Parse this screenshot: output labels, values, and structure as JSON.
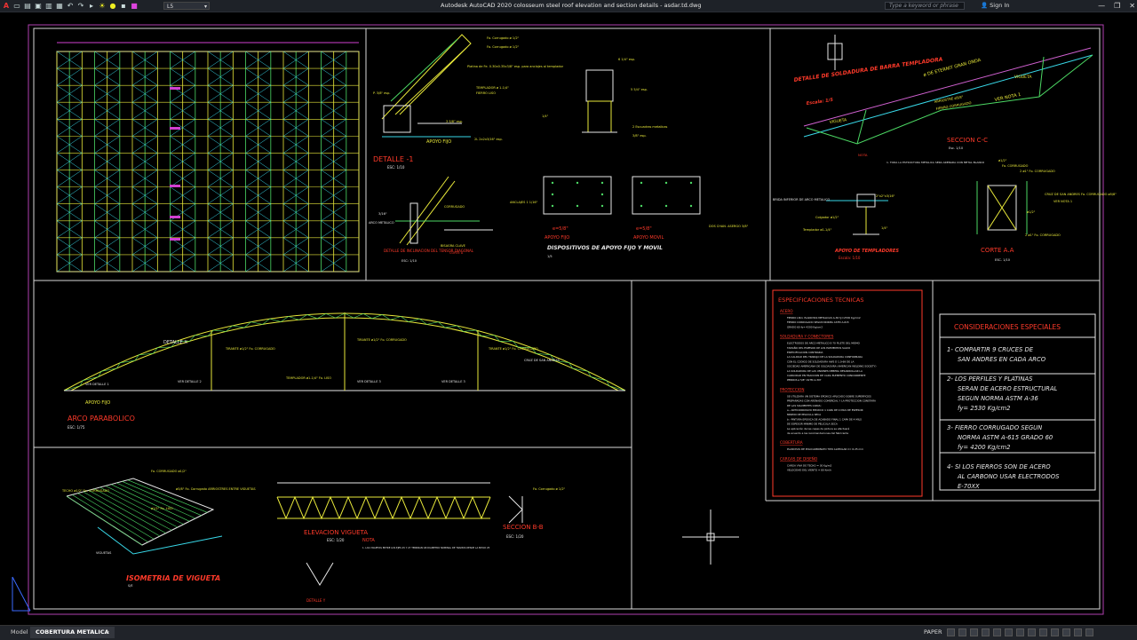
{
  "titlebar": {
    "app_title": "Autodesk AutoCAD 2020    colosseum steel roof elevation and section details - asdar.td.dwg",
    "layer": "L5",
    "search_placeholder": "Type a keyword or phrase",
    "signin": "Sign In",
    "quick_access_icons": [
      "app-menu-icon",
      "new-icon",
      "open-icon",
      "save-icon",
      "saveas-icon",
      "plot-icon",
      "undo-icon",
      "redo-icon",
      "share-icon"
    ],
    "window_buttons": [
      "—",
      "❐",
      "✕"
    ]
  },
  "colors": {
    "yellow": "#e8e83a",
    "green": "#4cd964",
    "cyan": "#38d8e8",
    "magenta": "#d040d0",
    "red": "#ff3a2a",
    "white": "#e8e8e8",
    "blue": "#3a6aff",
    "border": "#cfcfcf"
  },
  "drawing": {
    "detalle1": {
      "title": "DETALLE -1",
      "scale": "ESC: 1/10",
      "apoyo": "APOYO FIJO",
      "notes": [
        "Fo. Corrugado ø 1/2\"",
        "Fo. Corrugado ø 1/2\"",
        "Platina de Fe. 0.30x0.35x3/8\" esp. para anclajes al templador",
        "TEMPLADOR ø 1-1/4\"",
        "FIERRO LISO",
        "P. 3/8\" esp.",
        "3 5/8\" esp.",
        "2L 2x2x3/16\" esp."
      ]
    },
    "detalle_inclinacion": {
      "title": "DETALLE DE INCLINACION DEL TENSOR DIAGONAL",
      "scale": "ESC: 1/10",
      "labels": [
        "ARCO METALICO",
        "3/16\"",
        "BISAGRA CLAVE",
        "CORTE A",
        "CORRUGADO"
      ]
    },
    "dispositivos": {
      "title": "DISPOSITIVOS DE APOYO FIJO Y MOVIL",
      "scale": "1/5",
      "apoyo_fijo": "APOYO FIJO",
      "apoyo_movil": "APOYO MOVIL",
      "rec1": "e=5/8\"",
      "rec2": "e=5/8\"",
      "anclaje": "ANCLAJES 1 1/16\"",
      "labels": [
        "6 1/4\" esp.",
        "5 5/4\" esp.",
        "2 Escuadras metalicas",
        "3/8\" esp.",
        "1/4\"",
        "DOS CHAN. ASERGO 3/8\""
      ]
    },
    "detalle_soldadura": {
      "title": "DETALLE DE SOLDADURA DE BARRA TEMPLADORA",
      "scale": "Escala: 1/5"
    },
    "seccion_cc": {
      "title": "SECCION C-C",
      "scale": "Esc. 1/10",
      "labels": [
        "ø DE ETERNIT GRAN ONDA",
        "VIGUETA",
        "ARRIOSTRE ø5/8\"",
        "FIERRO CORRUGADO",
        "VER NOTA 1",
        "VIGUETA",
        "NOTA"
      ],
      "nota": "1. TODA LA ESTRUCTURA METALICA SERA ARENADA CON METAL BLANCO"
    },
    "apoyo_templadores": {
      "title": "APOYO DE TEMPLADORES",
      "scale": "Escala: 1/10",
      "labels": [
        "BRIDA INFERIOR DE ARCO METALICO",
        "Colgador ø1/2\"",
        "Templador ø1-1/4\"",
        "2\"x2\"x3/16\"",
        "1/4\""
      ]
    },
    "corte_aa": {
      "title": "CORTE A.A",
      "scale": "ESC. 1/10",
      "labels": [
        "ø1/2\"",
        "Fo. CORRUGADO",
        "2 ø1\" Fo. CORRUGADO",
        "CRUZ DE SAN ANDRES Fo. CORRUGADO ø5/8\"",
        "VER NOTA 1",
        "ø1/2\"",
        "2 ø1\" Fo. CORRUGADO"
      ]
    },
    "arco": {
      "title": "ARCO PARABOLICO",
      "scale": "ESC: 1/75",
      "detalle_x": "DETALLE X",
      "apoyo": "APOYO FIJO",
      "ver_detalle": "VER DETALLE 1",
      "cruz": "CRUZ DE SAN ANDRES",
      "tirante_labels": [
        "TIRANTE ø1/2\" Fo. CORRUGADO",
        "TIRANTE ø1/2\" Fo. CORRUGADO",
        "TIRANTE ø1/2\" Fo. CORRUGADO"
      ],
      "templador_labels": [
        "VER DETALLE 2",
        "TEMPLADOR ø1-1/4\" Fo. LISO",
        "VER DETALLE 3",
        "VER DETALLE 3"
      ]
    },
    "isometria": {
      "title": "ISOMETRIA DE VIGUETA",
      "scale": "S/E",
      "labels": [
        "Fo. CORRUGADO ø1/2\"",
        "TECHO ø1/2\" Fo. CORRUGADO",
        "ø3/8\" Fo. Corrugado ARRIOSTRES ENTRE VIGUETAS",
        "ø1/2\" Fo. LISO",
        "VIGUETAS"
      ]
    },
    "elevacion_vigueta": {
      "title": "ELEVACION VIGUETA",
      "scale": "ESC: 1/20",
      "nota_title": "NOTA",
      "nota": "1. LAS VIGUETAS ENTRE LOS EJES 25 Y 27 TENDRAN UN DIAMETRO NOMINAL DE TRAMOS DESDE LA MITAD 25",
      "detalle_y": "DETALLE Y"
    },
    "seccion_bb": {
      "title": "SECCION B-B",
      "scale": "ESC: 1/20",
      "label": "Fo. Corrugado ø 1/2\""
    },
    "especificaciones": {
      "title": "ESPECIFICACIONES TECNICAS",
      "sections": [
        {
          "head": "ACERO",
          "lines": [
            "FIERRO LISO, PLANCHAS METALICAS A-36 fy=2530 Kg/cm2",
            "FIERRO CORRUGADO SEGUN NORMA ASTM A-615",
            "GRADO 60 fy= 4200 Kg/cm2"
          ]
        },
        {
          "head": "SOLDADURA Y CONECTORES",
          "lines": [
            "ELECTRODOS DE ARCO METALICO E-70 FILETE DEL MISMO",
            "TAMAÑO DEL ESPESOR DE LOS ELEMENTOS SALVO",
            "ESPECIFICACION CONTRARIA",
            "LA CALIDAD DEL TRABAJO DE LA SOLDADURA CONFORMARA",
            "CON EL CODIGO DE SOLDADURA AWS D 1.0-69 DE LA",
            "SOCIEDAD AMERICANA DE SOLDADURA (AMERICAN WELDING SOCIETY)",
            "LA SOLDADURA DE LAS UNIONES DEBERA DESARROLLAR LA",
            "CAPACIDAD EN TRACCION DE CADA ELEMENTO CONCURRENTE",
            "PERNOS ø 5/8\" ASTM A-307"
          ]
        },
        {
          "head": "PROTECCION",
          "lines": [
            "SE UTILIZARA UN SISTEMA EPOXICO APLICADO SOBRE SUPERFICIES",
            "PREPARADAS CON ARENADO COMERCIAL Y LA PROTECCION CONSTARA",
            "DE LAS SIGUIENTES CAPAS:",
            "a.- ANTICORROSIVO EPOXICO 1 CAPA DE 4 MILS DE ESPESOR",
            "    MINIMO DE PELICULA SECA",
            "b.- PINTURA EPOXICA DE ACABADO FINAL 1 CAPA DE 4 MILS",
            "    DE ESPESOR MINIMO DE PELICULA SECA",
            "    La aplicación de las capas de pintura se efectuará",
            "    de acuerdo a las recomendaciones del fabricante"
          ]
        },
        {
          "head": "COBERTURA",
          "lines": [
            "PLANCHAS DE POLICARBONATO TIPO ALVEOLAR C= 6.25 mm"
          ]
        },
        {
          "head": "CARGAS DE DISEÑO",
          "lines": [
            "CARGA VIVA DE TECHO = 30 Kg/m2",
            "VELOCIDAD DEL VIENTO = 80 Km/h"
          ]
        }
      ]
    },
    "consideraciones": {
      "title": "CONSIDERACIONES ESPECIALES",
      "items": [
        [
          "1- COMPARTIR 9 CRUCES DE",
          "SAN ANDRES EN CADA ARCO"
        ],
        [
          "2- LOS PERFILES Y PLATINAS",
          "SERAN DE ACERO ESTRUCTURAL",
          "SEGUN NORMA ASTM A-36",
          "fy= 2530 Kg/cm2"
        ],
        [
          "3- FIERRO CORRUGADO SEGUN",
          "NORMA ASTM A-615 GRADO 60",
          "fy= 4200 Kg/cm2"
        ],
        [
          "4- SI LOS FIERROS SON DE ACERO",
          "AL CARBONO USAR ELECTRODOS",
          "E-70XX"
        ]
      ]
    }
  },
  "statusbar": {
    "tabs": [
      "Model",
      "COBERTURA METALICA",
      "+"
    ],
    "paper": "PAPER",
    "icon_names": [
      "grid-icon",
      "snap-icon",
      "ortho-icon",
      "polar-icon",
      "osnap-icon",
      "otrack-icon",
      "lineweight-icon",
      "transparency-icon",
      "workspace-icon",
      "annotation-icon",
      "settings-icon",
      "fullscreen-icon",
      "menu-icon"
    ]
  }
}
